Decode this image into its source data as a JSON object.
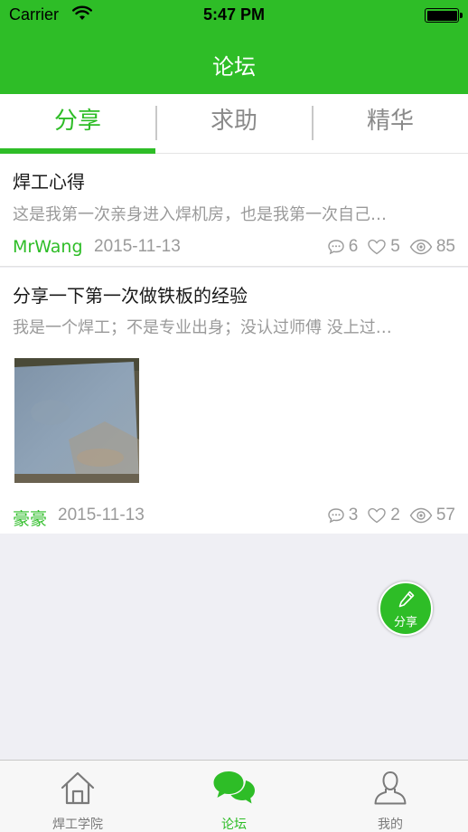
{
  "status_bar": {
    "carrier": "Carrier",
    "time": "5:47 PM"
  },
  "nav": {
    "title": "论坛"
  },
  "segments": [
    {
      "label": "分享",
      "active": true
    },
    {
      "label": "求助",
      "active": false
    },
    {
      "label": "精华",
      "active": false
    }
  ],
  "posts": [
    {
      "title": "焊工心得",
      "excerpt": "这是我第一次亲身进入焊机房，也是我第一次自己…",
      "author": "MrWang",
      "date": "2015-11-13",
      "comments": "6",
      "likes": "5",
      "views": "85"
    },
    {
      "title": "分享一下第一次做铁板的经验",
      "excerpt": "我是一个焊工；不是专业出身；没认过师傅 没上过…",
      "author": "豪豪",
      "date": "2015-11-13",
      "comments": "3",
      "likes": "2",
      "views": "57"
    }
  ],
  "fab": {
    "label": "分享",
    "icon": "pencil-icon"
  },
  "tabbar": [
    {
      "label": "焊工学院",
      "icon": "house-icon",
      "active": false
    },
    {
      "label": "论坛",
      "icon": "chat-bubbles-icon",
      "active": true
    },
    {
      "label": "我的",
      "icon": "person-icon",
      "active": false
    }
  ],
  "colors": {
    "accent": "#2ebd27",
    "muted_text": "#9a9a9a",
    "background": "#efeff4"
  }
}
